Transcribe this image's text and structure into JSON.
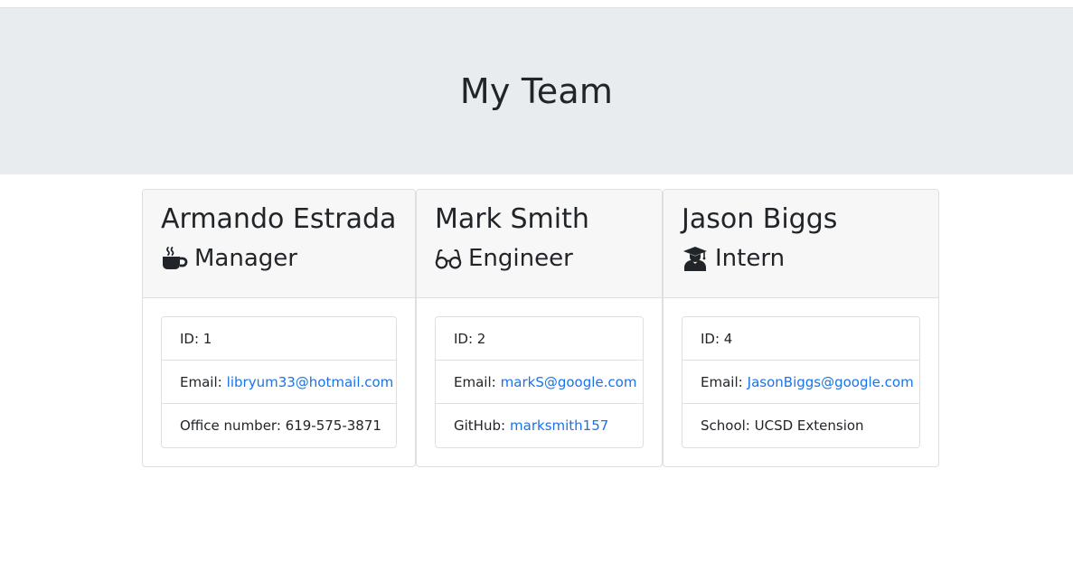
{
  "page": {
    "title": "My Team"
  },
  "team": [
    {
      "name": "Armando Estrada",
      "role": "Manager",
      "icon": "coffee-icon",
      "fields": [
        {
          "label": "ID: 1",
          "link": ""
        },
        {
          "label": "Email:",
          "link": "libryum33@hotmail.com"
        },
        {
          "label": "Office number: 619-575-3871",
          "link": ""
        }
      ]
    },
    {
      "name": "Mark Smith",
      "role": "Engineer",
      "icon": "glasses-icon",
      "fields": [
        {
          "label": "ID: 2",
          "link": ""
        },
        {
          "label": "Email:",
          "link": "markS@google.com"
        },
        {
          "label": "GitHub:",
          "link": "marksmith157"
        }
      ]
    },
    {
      "name": "Jason Biggs",
      "role": "Intern",
      "icon": "graduate-icon",
      "fields": [
        {
          "label": "ID: 4",
          "link": ""
        },
        {
          "label": "Email:",
          "link": "JasonBiggs@google.com"
        },
        {
          "label": "School: UCSD Extension",
          "link": ""
        }
      ]
    }
  ],
  "colors": {
    "header_bg": "#e9ecef",
    "card_header_bg": "#f7f7f7",
    "link": "#1a73e8",
    "text": "#212529"
  }
}
